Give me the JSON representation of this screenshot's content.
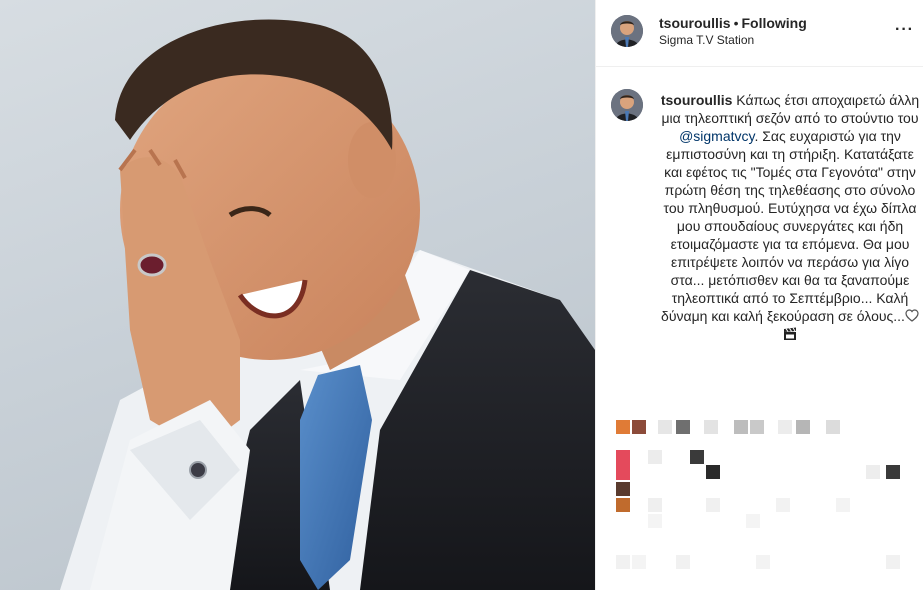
{
  "post": {
    "username": "tsouroullis",
    "separator": "•",
    "follow_state": "Following",
    "location": "Sigma T.V Station",
    "more_icon": "more-horizontal-icon",
    "more_label": "···"
  },
  "photo": {
    "description_icon": "post-photo"
  },
  "caption": {
    "username": "tsouroullis",
    "text_part1": "Κάπως έτσι αποχαιρετώ άλλη μια τηλεοπτική σεζόν από το στούντιο του",
    "mention": "@sigmatvcy",
    "text_part2": ". Σας ευχαριστώ για την εμπιστοσύνη και τη στήριξη. Κατατάξατε και εφέτος τις \"Τομές στα Γεγονότα\" στην πρώτη θέση της τηλεθέασης στο σύνολο του πληθυσμού. Ευτύχησα να έχω δίπλα μου σπουδαίους συνεργάτες και ήδη ετοιμαζόμαστε για τα επόμενα. Θα μου επιτρέψετε λοιπόν να περάσω για λίγο στα... μετόπισθεν και θα τα ξαναπούμε τηλεοπτικά από το Σεπτέμβριο... Καλή δύναμη και καλή ξεκούραση σε όλους...",
    "emoji_1": "white-heart-icon",
    "emoji_2": "clapper-board-icon"
  },
  "colors": {
    "mention": "#003569",
    "text": "#262626",
    "divider": "#efefef"
  }
}
